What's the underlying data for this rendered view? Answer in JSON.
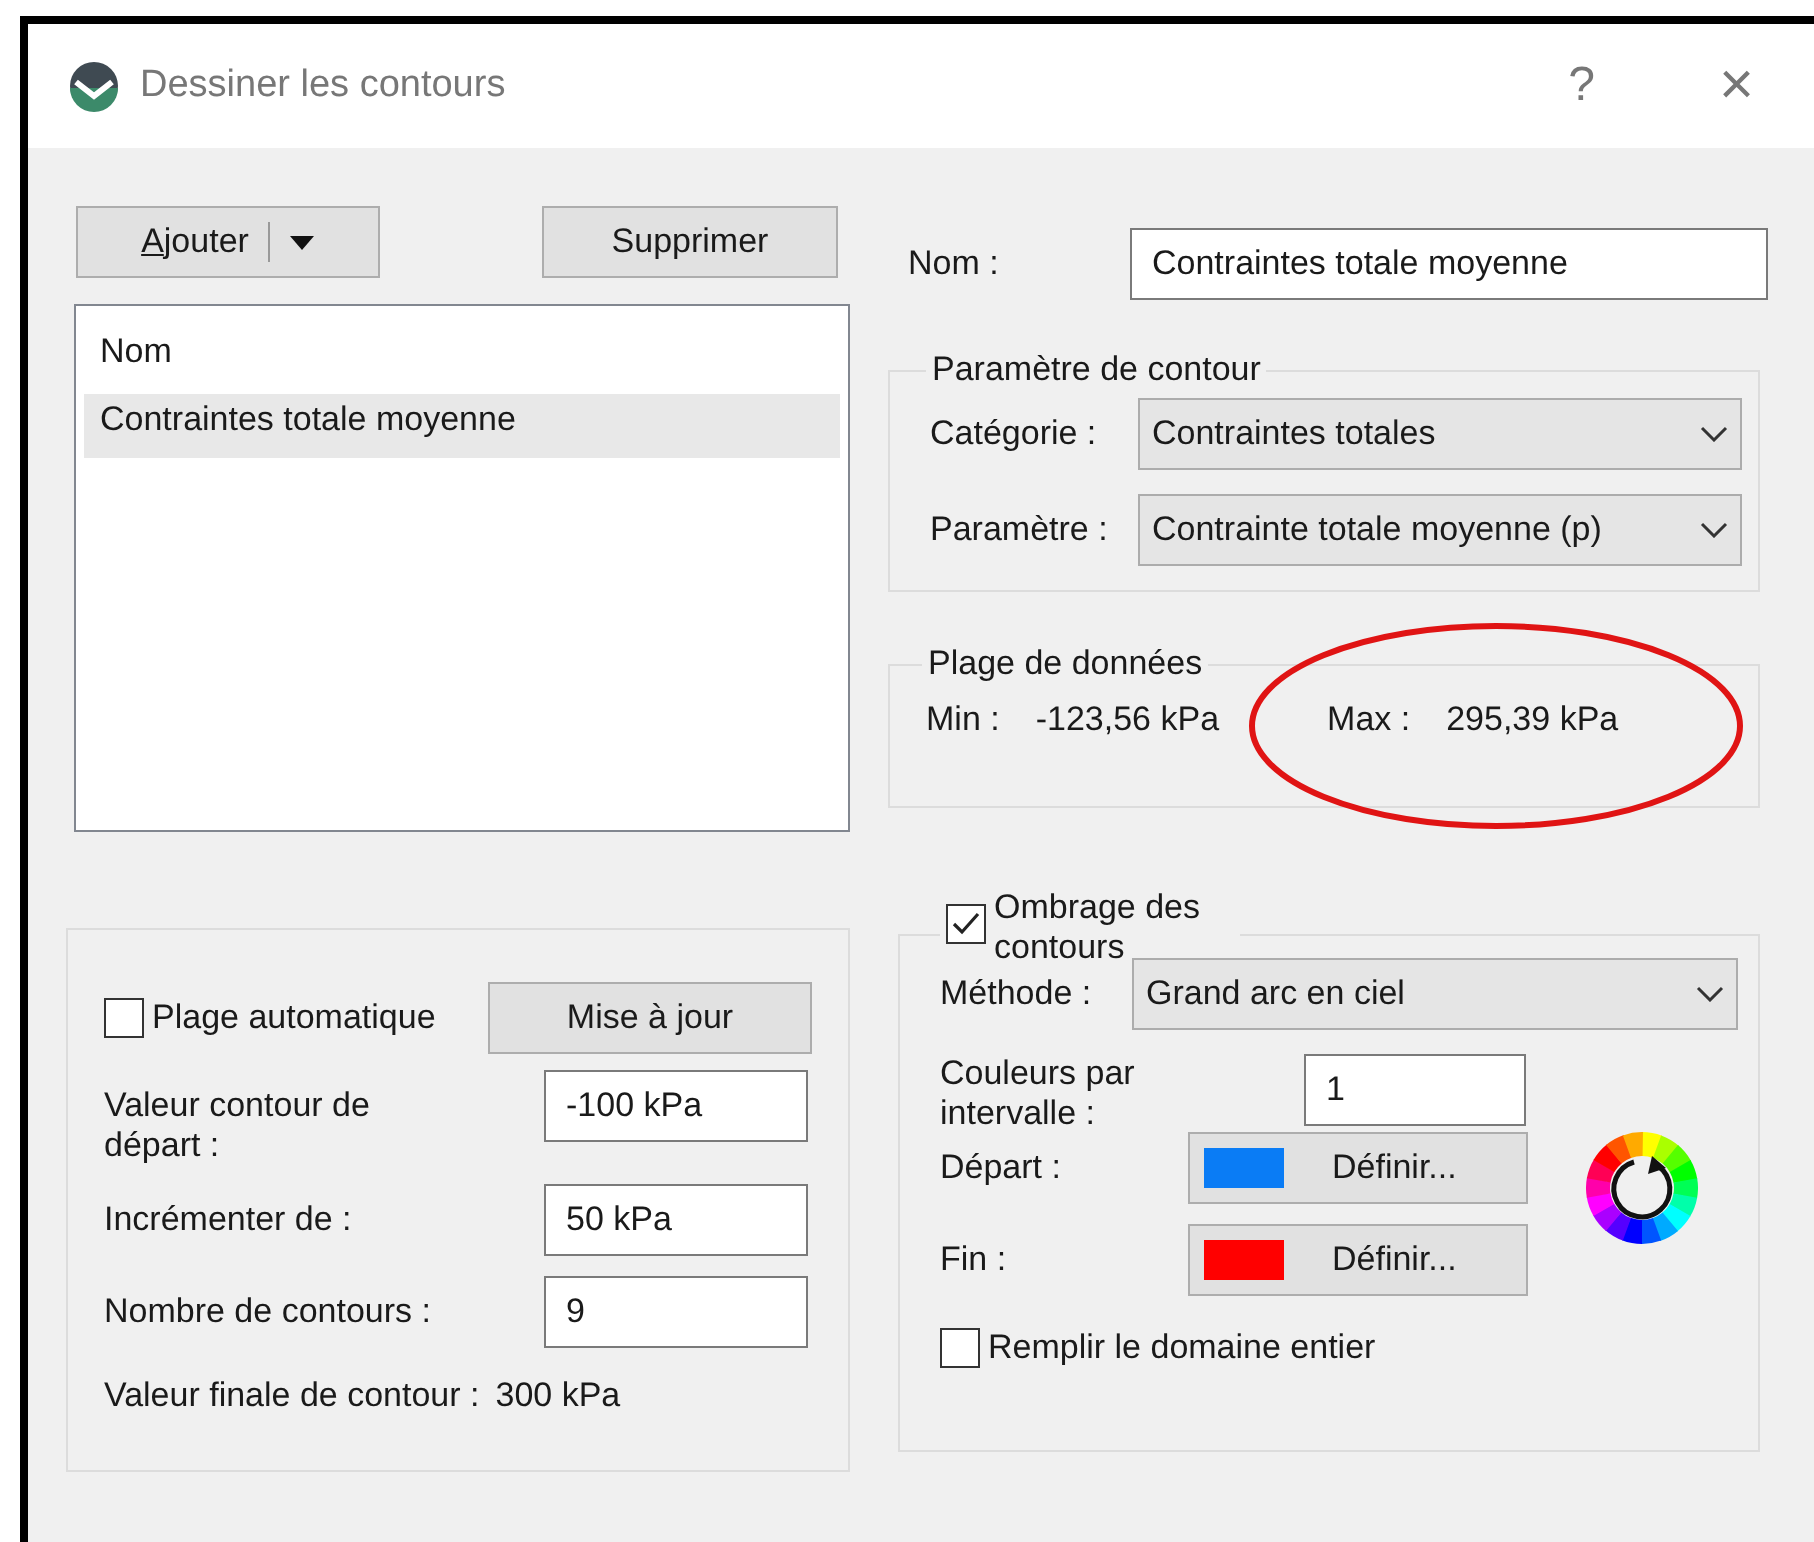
{
  "window": {
    "title": "Dessiner les contours",
    "help": "?",
    "close": "×"
  },
  "toolbar": {
    "add": "Ajouter",
    "remove": "Supprimer"
  },
  "list": {
    "header": "Nom",
    "items": [
      {
        "label": "Contraintes totale moyenne",
        "selected": true
      }
    ]
  },
  "name_field": {
    "label": "Nom :",
    "value": "Contraintes totale moyenne"
  },
  "contour_parameter": {
    "title": "Paramètre de contour",
    "rows": [
      {
        "label": "Catégorie :",
        "value": "Contraintes totales"
      },
      {
        "label": "Paramètre :",
        "value": "Contrainte totale moyenne (p)"
      }
    ]
  },
  "data_range": {
    "title": "Plage de données",
    "min_label": "Min :",
    "min": "-123,56 kPa",
    "max_label": "Max :",
    "max": "295,39 kPa",
    "max_highlighted": true
  },
  "range": {
    "auto": {
      "label": "Plage automatique",
      "checked": false
    },
    "update_button": "Mise à jour",
    "fields": [
      {
        "label": "Valeur contour de départ :",
        "value": "-100 kPa"
      },
      {
        "label": "Incrémenter de :",
        "value": "50 kPa"
      },
      {
        "label": "Nombre de contours :",
        "value": "9"
      }
    ],
    "final_label": "Valeur finale de contour :",
    "final_value": "300 kPa"
  },
  "shading": {
    "label": "Ombrage des contours",
    "checked": true,
    "method_label": "Méthode :",
    "method": "Grand arc en ciel",
    "colors_label": "Couleurs par intervalle :",
    "colors_value": "1",
    "colors": [
      {
        "label": "Départ :",
        "color": "#0a7cf5",
        "button": "Définir..."
      },
      {
        "label": "Fin :",
        "color": "#ff0000",
        "button": "Définir..."
      }
    ],
    "fill": {
      "label": "Remplir le domaine entier",
      "checked": false
    }
  }
}
